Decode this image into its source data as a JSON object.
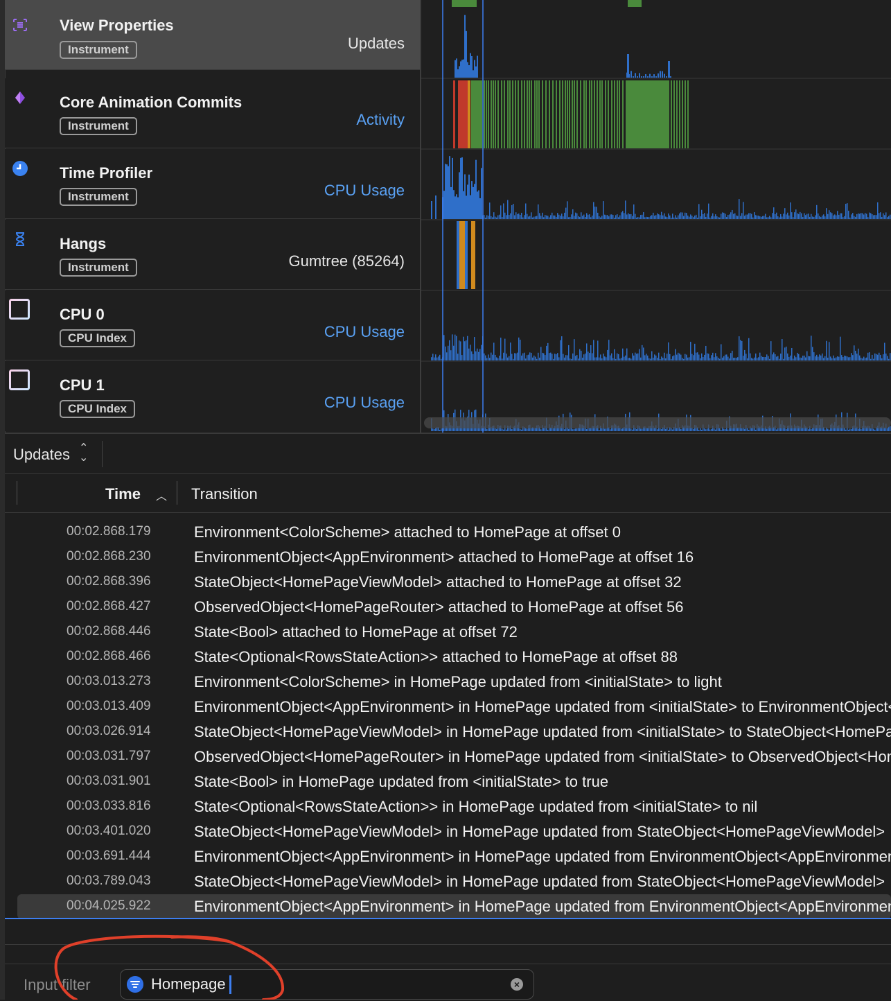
{
  "tracks": [
    {
      "title": "View Properties",
      "badge": "Instrument",
      "right": "Updates",
      "right_style": "white",
      "icon": "view-properties-icon",
      "selected": true
    },
    {
      "title": "Core Animation Commits",
      "badge": "Instrument",
      "right": "Activity",
      "right_style": "blue",
      "icon": "core-animation-icon"
    },
    {
      "title": "Time Profiler",
      "badge": "Instrument",
      "right": "CPU Usage",
      "right_style": "blue",
      "icon": "time-profiler-icon"
    },
    {
      "title": "Hangs",
      "badge": "Instrument",
      "right": "Gumtree (85264)",
      "right_style": "white",
      "icon": "hourglass-icon"
    },
    {
      "title": "CPU 0",
      "badge": "CPU Index",
      "right": "CPU Usage",
      "right_style": "blue",
      "icon": "cpu-square-icon"
    },
    {
      "title": "CPU 1",
      "badge": "CPU Index",
      "right": "CPU Usage",
      "right_style": "blue",
      "icon": "cpu-square-icon"
    }
  ],
  "detail": {
    "selector_label": "Updates",
    "columns": {
      "time": "Time",
      "transition": "Transition"
    },
    "rows": [
      {
        "time": "00:02.868.179",
        "transition": "Environment<ColorScheme> attached to HomePage at offset 0"
      },
      {
        "time": "00:02.868.230",
        "transition": "EnvironmentObject<AppEnvironment> attached to HomePage at offset 16"
      },
      {
        "time": "00:02.868.396",
        "transition": "StateObject<HomePageViewModel> attached to HomePage at offset 32"
      },
      {
        "time": "00:02.868.427",
        "transition": "ObservedObject<HomePageRouter> attached to HomePage at offset 56"
      },
      {
        "time": "00:02.868.446",
        "transition": "State<Bool> attached to HomePage at offset 72"
      },
      {
        "time": "00:02.868.466",
        "transition": "State<Optional<RowsStateAction>> attached to HomePage at offset 88"
      },
      {
        "time": "00:03.013.273",
        "transition": "Environment<ColorScheme> in HomePage updated from <initialState> to light"
      },
      {
        "time": "00:03.013.409",
        "transition": "EnvironmentObject<AppEnvironment> in HomePage updated from <initialState> to EnvironmentObject<AppEnvironment>"
      },
      {
        "time": "00:03.026.914",
        "transition": "StateObject<HomePageViewModel> in HomePage updated from <initialState> to StateObject<HomePageViewModel>"
      },
      {
        "time": "00:03.031.797",
        "transition": "ObservedObject<HomePageRouter> in HomePage updated from <initialState> to ObservedObject<HomePageRouter>"
      },
      {
        "time": "00:03.031.901",
        "transition": "State<Bool> in HomePage updated from <initialState> to true"
      },
      {
        "time": "00:03.033.816",
        "transition": "State<Optional<RowsStateAction>> in HomePage updated from <initialState> to nil"
      },
      {
        "time": "00:03.401.020",
        "transition": "StateObject<HomePageViewModel> in HomePage updated from StateObject<HomePageViewModel>"
      },
      {
        "time": "00:03.691.444",
        "transition": "EnvironmentObject<AppEnvironment> in HomePage updated from EnvironmentObject<AppEnvironment>"
      },
      {
        "time": "00:03.789.043",
        "transition": "StateObject<HomePageViewModel> in HomePage updated from StateObject<HomePageViewModel>"
      },
      {
        "time": "00:04.025.922",
        "transition": "EnvironmentObject<AppEnvironment> in HomePage updated from EnvironmentObject<AppEnvironment>",
        "selected": true
      }
    ]
  },
  "filter": {
    "label": "Input filter",
    "value": "Homepage"
  },
  "colors": {
    "accent_blue": "#5aa2f5",
    "graph_blue": "#2f6fc9",
    "graph_green": "#4a8a3c",
    "graph_red": "#c0392b",
    "graph_orange": "#d08a1e",
    "annotation_red": "#e0402a"
  }
}
